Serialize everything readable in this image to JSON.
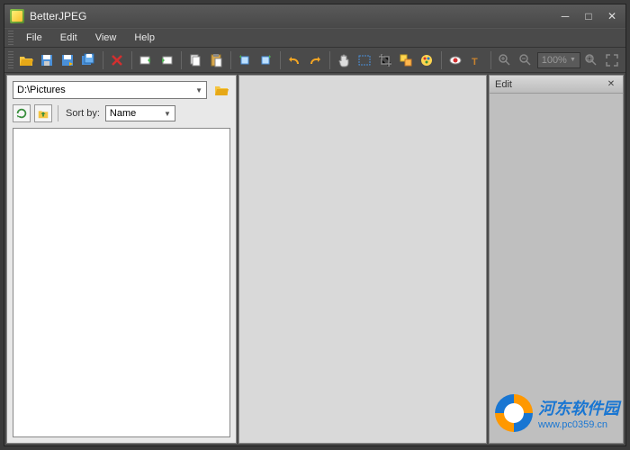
{
  "app": {
    "title": "BetterJPEG"
  },
  "menu": {
    "file": "File",
    "edit": "Edit",
    "view": "View",
    "help": "Help"
  },
  "toolbar": {
    "zoom_value": "100%"
  },
  "browser": {
    "path": "D:\\Pictures",
    "sort_label": "Sort by:",
    "sort_value": "Name"
  },
  "right_panel": {
    "title": "Edit"
  },
  "watermark": {
    "text": "河东软件园",
    "url": "www.pc0359.cn"
  }
}
